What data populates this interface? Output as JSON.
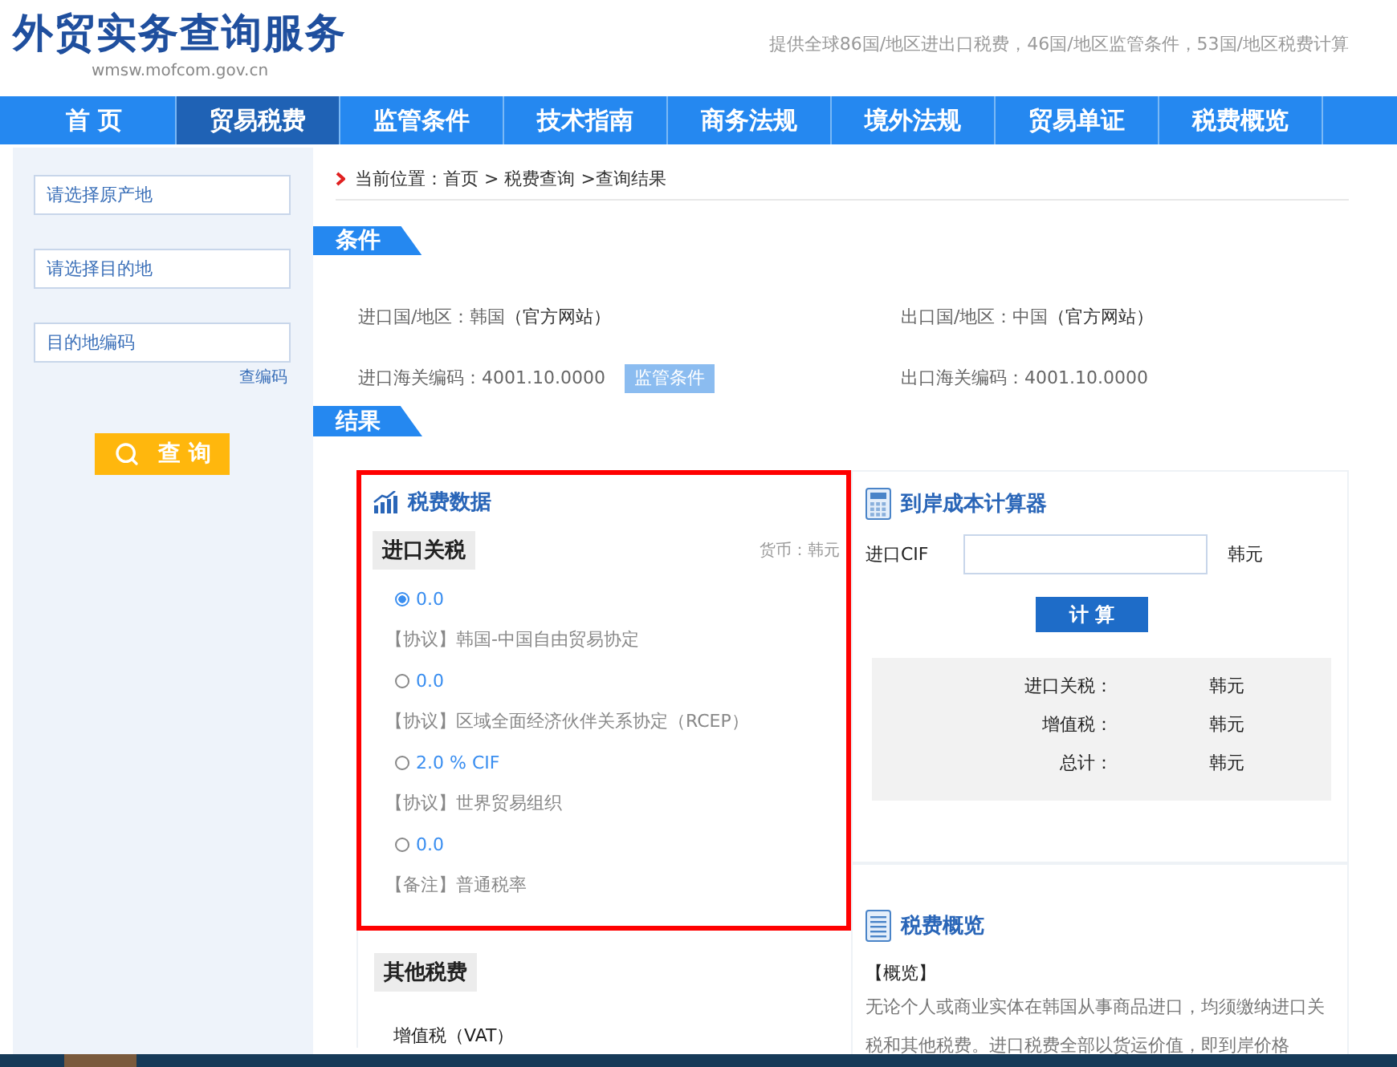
{
  "header": {
    "title": "外贸实务查询服务",
    "domain": "wmsw.mofcom.gov.cn",
    "tagline": "提供全球86国/地区进出口税费，46国/地区监管条件，53国/地区税费计算"
  },
  "nav": [
    {
      "label": "首 页",
      "selected": false
    },
    {
      "label": "贸易税费",
      "selected": true
    },
    {
      "label": "监管条件",
      "selected": false
    },
    {
      "label": "技术指南",
      "selected": false
    },
    {
      "label": "商务法规",
      "selected": false
    },
    {
      "label": "境外法规",
      "selected": false
    },
    {
      "label": "贸易单证",
      "selected": false
    },
    {
      "label": "税费概览",
      "selected": false
    }
  ],
  "sidebar": {
    "fields": [
      {
        "placeholder": "请选择原产地"
      },
      {
        "placeholder": "请选择目的地"
      },
      {
        "placeholder": "目的地编码"
      }
    ],
    "lookup_link": "查编码",
    "search_button": "查 询"
  },
  "breadcrumb": "当前位置：首页 > 税费查询 >查询结果",
  "conditions": {
    "heading": "条件",
    "items": [
      {
        "text": "进口国/地区：韩国",
        "link": "（官方网站）"
      },
      {
        "text": "出口国/地区：中国",
        "link": "（官方网站）"
      },
      {
        "text": "进口海关编码：4001.10.0000",
        "button": "监管条件"
      },
      {
        "text": "出口海关编码：4001.10.0000"
      }
    ]
  },
  "results": {
    "heading": "结果",
    "tax_data": {
      "title": "税费数据",
      "import_duty": {
        "heading": "进口关税",
        "currency": "货币：韩元",
        "options": [
          {
            "rate": "0.0",
            "note": "【协议】韩国-中国自由贸易协定",
            "selected": true
          },
          {
            "rate": "0.0",
            "note": "【协议】区域全面经济伙伴关系协定（RCEP）",
            "selected": false
          },
          {
            "rate": "2.0 % CIF",
            "note": "【协议】世界贸易组织",
            "selected": false
          },
          {
            "rate": "0.0",
            "note": "【备注】普通税率",
            "selected": false
          }
        ]
      },
      "other": {
        "heading": "其他税费",
        "items": [
          "增值税（VAT）"
        ]
      }
    },
    "calculator": {
      "title": "到岸成本计算器",
      "cif_label": "进口CIF",
      "unit": "韩元",
      "button": "计 算",
      "rows": [
        {
          "label": "进口关税：",
          "unit": "韩元"
        },
        {
          "label": "增值税：",
          "unit": "韩元"
        },
        {
          "label": "总计：",
          "unit": "韩元"
        }
      ]
    },
    "overview": {
      "title": "税费概览",
      "heading": "【概览】",
      "text": "无论个人或商业实体在韩国从事商品进口，均须缴纳进口关税和其他税费。进口税费全部以货运价值，即到岸价格"
    }
  }
}
